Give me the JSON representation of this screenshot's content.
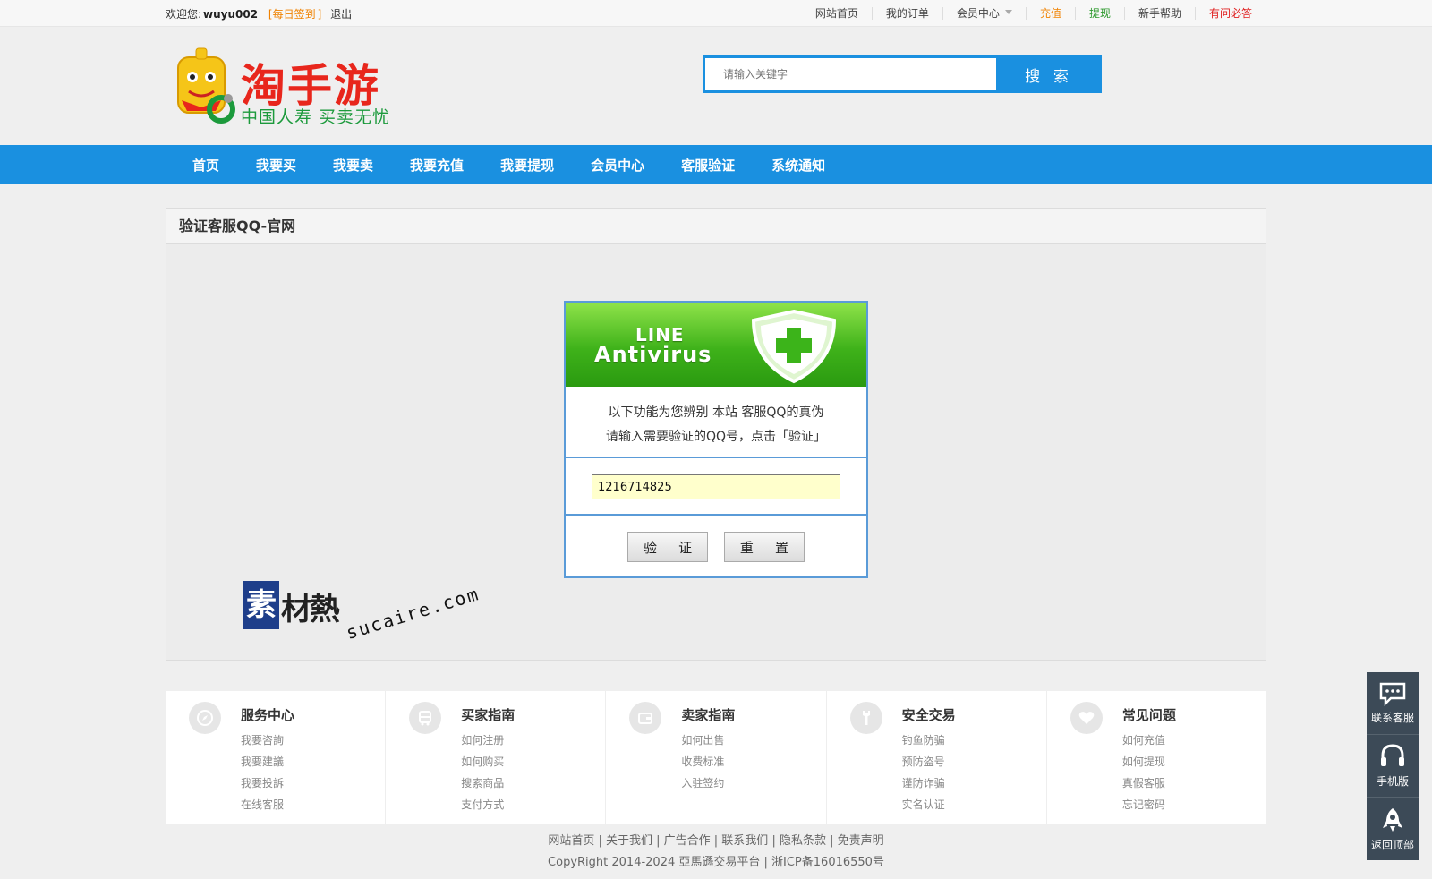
{
  "topbar": {
    "welcome": "欢迎您:",
    "username": "wuyu002",
    "bracket_open": "[",
    "daily_sign": "每日签到",
    "bracket_close": "]",
    "logout": "退出",
    "links": [
      {
        "label": "网站首页",
        "style": "normal"
      },
      {
        "label": "我的订单",
        "style": "normal"
      },
      {
        "label": "会员中心",
        "style": "dropdown"
      },
      {
        "label": "充值",
        "style": "orange"
      },
      {
        "label": "提现",
        "style": "green"
      },
      {
        "label": "新手帮助",
        "style": "normal"
      },
      {
        "label": "有问必答",
        "style": "red"
      }
    ]
  },
  "logo": {
    "title": "淘手游",
    "slogan": "中国人寿 买卖无忧"
  },
  "search": {
    "placeholder": "请输入关键字",
    "button": "搜 索"
  },
  "nav": [
    "首页",
    "我要买",
    "我要卖",
    "我要充值",
    "我要提现",
    "会员中心",
    "客服验证",
    "系统通知"
  ],
  "panel": {
    "title": "验证客服QQ-官网"
  },
  "verify": {
    "banner_line1": "LINE",
    "banner_line2": "Antivirus",
    "desc_line1": "以下功能为您辨别 本站 客服QQ的真伪",
    "desc_line2": "请输入需要验证的QQ号，点击「验证」",
    "qq_value": "1216714825",
    "verify_button": "验 证",
    "reset_button": "重 置"
  },
  "watermark": {
    "block": "素",
    "cn": "材熱",
    "en": "sucaire.com"
  },
  "guide": [
    {
      "title": "服务中心",
      "icon": "compass-icon",
      "links": [
        "我要咨詢",
        "我要建議",
        "我要投訴",
        "在线客服"
      ]
    },
    {
      "title": "买家指南",
      "icon": "bus-icon",
      "links": [
        "如何注册",
        "如何购买",
        "搜索商品",
        "支付方式"
      ]
    },
    {
      "title": "卖家指南",
      "icon": "wallet-icon",
      "links": [
        "如何出售",
        "收费标准",
        "入驻签约"
      ]
    },
    {
      "title": "安全交易",
      "icon": "wrench-icon",
      "links": [
        "钓鱼防骗",
        "预防盗号",
        "谨防诈骗",
        "实名认证"
      ]
    },
    {
      "title": "常见问题",
      "icon": "heart-icon",
      "links": [
        "如何充值",
        "如何提现",
        "真假客服",
        "忘记密码"
      ]
    }
  ],
  "footer": {
    "links_line": "网站首页 | 关于我们 | 广告合作 | 联系我们 | 隐私条款 | 免责声明",
    "copyright": "CopyRight 2014-2024 亞馬遜交易平台 | 浙ICP备16016550号"
  },
  "side_tools": [
    {
      "label": "联系客服",
      "icon": "chat-icon"
    },
    {
      "label": "手机版",
      "icon": "headset-icon"
    },
    {
      "label": "返回顶部",
      "icon": "rocket-icon"
    }
  ],
  "colors": {
    "brand_blue": "#1a90e0",
    "logo_red": "#e8261c",
    "slogan_green": "#1c9a3c",
    "input_yellow": "#ffffcc"
  }
}
